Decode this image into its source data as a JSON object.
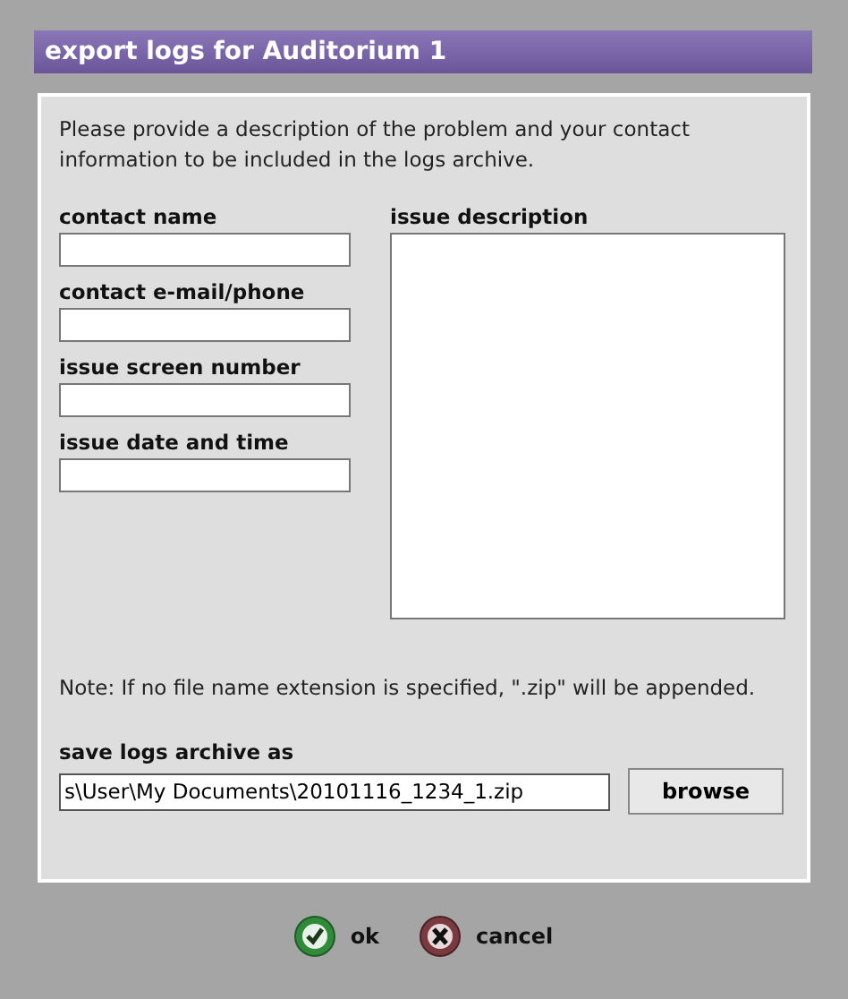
{
  "window": {
    "title": "export logs for Auditorium 1"
  },
  "intro": "Please provide a description of the problem and your contact information to be included in the logs archive.",
  "fields": [
    {
      "label": "contact name"
    },
    {
      "label": "contact e-mail/phone"
    },
    {
      "label": "issue screen number"
    },
    {
      "label": "issue date and time"
    }
  ],
  "description": {
    "label": "issue description"
  },
  "note": "Note: If no file name extension is specified, \".zip\" will be appended.",
  "archive": {
    "label": "save logs archive as",
    "value": "s\\User\\My Documents\\20101116_1234_1.zip",
    "browse": "browse"
  },
  "buttons": [
    {
      "kind": "ok",
      "label": "ok"
    },
    {
      "kind": "cancel",
      "label": "cancel"
    }
  ]
}
